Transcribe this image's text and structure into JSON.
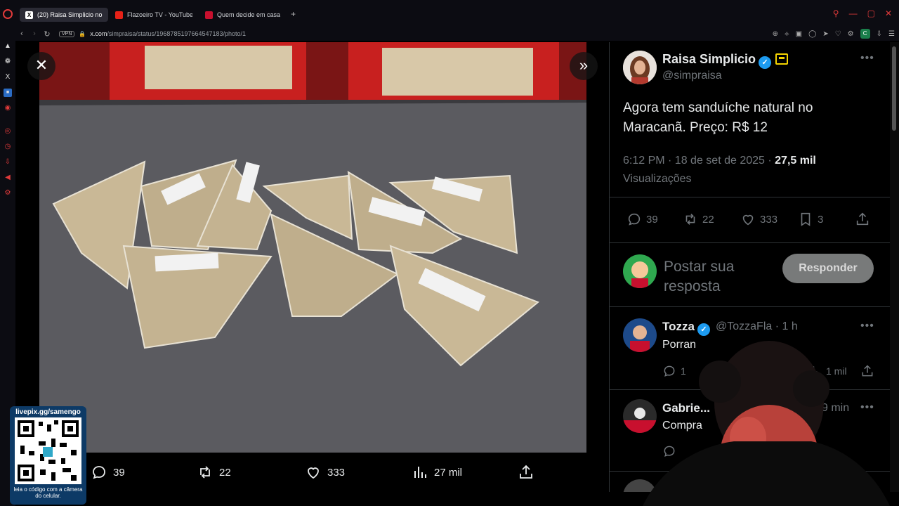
{
  "browser": {
    "tabs": [
      {
        "label": "(20) Raisa Simplicio no X:",
        "active": true,
        "favicon": "x-icon"
      },
      {
        "label": "Flazoeiro TV - YouTube",
        "active": false,
        "favicon": "youtube-icon"
      },
      {
        "label": "Quem decide em casa na",
        "active": false,
        "favicon": "news-icon"
      }
    ],
    "vpn_label": "VPN",
    "url_host": "x.com",
    "url_path": "/simpraisa/status/1968785197664547183/photo/1",
    "profile_initial": "C",
    "accent": "#e03a3a"
  },
  "viewer": {
    "actions": {
      "replies": "39",
      "reposts": "22",
      "likes": "333",
      "views": "27 mil"
    }
  },
  "tweet": {
    "author_name": "Raisa Simplicio",
    "author_handle": "@simpraisa",
    "text": "Agora tem sanduíche natural no Maracanã. Preço: R$ 12",
    "time": "6:12 PM · 18 de set de 2025 · ",
    "views_count": "27,5 mil",
    "views_label": "Visualizações",
    "stats": {
      "replies": "39",
      "reposts": "22",
      "likes": "333",
      "bookmarks": "3"
    },
    "reply_placeholder": "Postar sua resposta",
    "reply_button": "Responder"
  },
  "replies": [
    {
      "name": "Tozza",
      "handle": "@TozzaFla · 1 h",
      "text": "Porran",
      "reply_count": "1",
      "views": "1 mil"
    },
    {
      "name": "Gabrie...",
      "handle": "9 min",
      "text": "Compra"
    }
  ],
  "overlay": {
    "qr_title": "livepix.gg/samengo",
    "qr_note": "leia o código com a câmera do celular."
  },
  "colors": {
    "verified_blue": "#1d9bf0",
    "affiliate_gold": "#f4d400",
    "muted_text": "#71767b"
  }
}
